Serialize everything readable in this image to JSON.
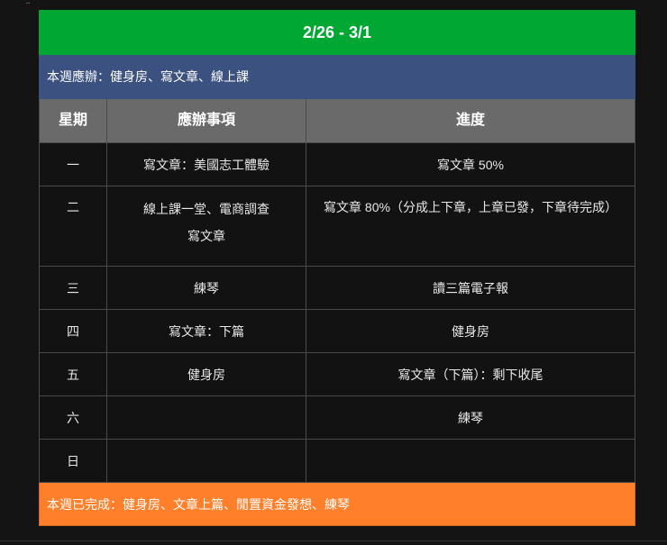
{
  "title": "2/26 - 3/1",
  "todo": "本週應辦：健身房、寫文章、線上課",
  "headers": [
    "星期",
    "應辦事項",
    "進度"
  ],
  "rows": [
    {
      "day": "一",
      "task": "寫文章：美國志工體驗",
      "progress": "寫文章 50%"
    },
    {
      "day": "二",
      "task": "線上課一堂、電商調查",
      "task2": "寫文章",
      "progress": "寫文章 80%（分成上下章，上章已發，下章待完成）"
    },
    {
      "day": "三",
      "task": "練琴",
      "progress": "讀三篇電子報"
    },
    {
      "day": "四",
      "task": "寫文章：下篇",
      "progress": "健身房"
    },
    {
      "day": "五",
      "task": "健身房",
      "progress": "寫文章（下篇）：剩下收尾"
    },
    {
      "day": "六",
      "task": "",
      "progress": "練琴"
    },
    {
      "day": "日",
      "task": "",
      "progress": ""
    }
  ],
  "done": "本週已完成：健身房、文章上篇、閒置資金發想、練琴"
}
